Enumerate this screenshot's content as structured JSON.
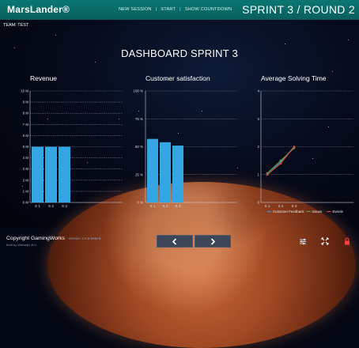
{
  "header": {
    "logo": "MarsLander®",
    "nav": [
      "NEW SESSION",
      "START",
      "SHOW COUNTDOWN"
    ],
    "round_title": "SPRINT 3 / ROUND 2"
  },
  "team_label": "TEAM: TEST",
  "dashboard_title": "DASHBOARD SPRINT 3",
  "colors": {
    "header": "#0a706c",
    "bar": "#35a6e4",
    "customer_feedback": "#3a8fd6",
    "issues": "#5aa34a",
    "events": "#e04a3a",
    "footer_button": "#3c4657",
    "lock_icon": "#ff3d3d"
  },
  "chart_data": [
    {
      "type": "bar",
      "title": "Revenue",
      "categories": [
        "S 1",
        "S 2",
        "S 3"
      ],
      "values": [
        5,
        5,
        5
      ],
      "ylim": [
        0,
        10
      ],
      "ytick_labels": [
        "0 M",
        "1 M",
        "2 M",
        "3 M",
        "4 M",
        "5 M",
        "6 M",
        "7 M",
        "8 M",
        "9 M",
        "10 M"
      ],
      "grid": true
    },
    {
      "type": "bar",
      "title": "Customer satisfaction",
      "categories": [
        "S 1",
        "S 2",
        "S 3"
      ],
      "values": [
        57,
        54,
        51
      ],
      "ylim": [
        0,
        100
      ],
      "ytick_labels": [
        "0 %",
        "25 %",
        "50 %",
        "75 %",
        "100 %"
      ],
      "grid": true
    },
    {
      "type": "line",
      "title": "Average Solving Time",
      "categories": [
        "S 1",
        "S 2",
        "S 3"
      ],
      "ylim": [
        0,
        4
      ],
      "ytick_labels": [
        "0",
        "1",
        "2",
        "3",
        "4"
      ],
      "grid": true,
      "legend_position": "bottom",
      "series": [
        {
          "name": "Customer Feedback",
          "values": [
            1.0,
            1.45,
            2.0
          ]
        },
        {
          "name": "Issues",
          "values": [
            1.05,
            1.5,
            1.95
          ]
        },
        {
          "name": "Events",
          "values": [
            1.0,
            1.4,
            2.0
          ]
        }
      ]
    }
  ],
  "footer": {
    "copyright": "Copyright GamingWorks",
    "version": "- Version 2.0.6 beta 5",
    "built_by": "Built by Webstijlo B.V.",
    "prev_icon": "chevron-left-icon",
    "next_icon": "chevron-right-icon",
    "tools": [
      "sliders-icon",
      "fullscreen-icon",
      "lock-icon"
    ]
  }
}
